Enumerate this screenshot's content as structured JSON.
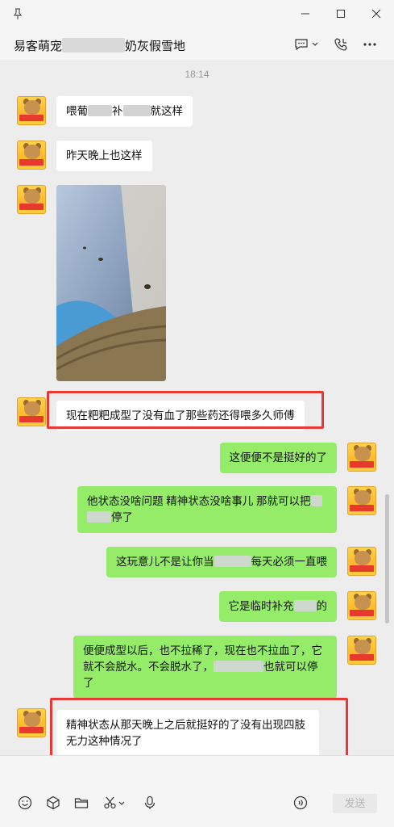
{
  "header": {
    "chat_title_left": "易客萌宠",
    "chat_title_right": "奶灰假雪地"
  },
  "messages": {
    "time": "18:14",
    "m1_a": "喂葡",
    "m1_b": "补",
    "m1_c": "就这样",
    "m2": "昨天晚上也这样",
    "m4": "现在粑粑成型了没有血了那些药还得喂多久师傅",
    "m5": "这便便不是挺好的了",
    "m6_a": "他状态没啥问题 精神状态没啥事儿 那就可以把",
    "m6_b": "停了",
    "m7_a": "这玩意儿不是让你当",
    "m7_b": "每天必须一直喂",
    "m8_a": "它是临时补充",
    "m8_b": "的",
    "m9_a": "便便成型以后，也不拉稀了，现在也不拉血了，它就不会脱水。不会脱水了，",
    "m9_b": "也就可以停了",
    "m10": "精神状态从那天晚上之后就挺好的了没有出现四肢无力这种情况了"
  },
  "input": {
    "send_label": "发送"
  },
  "icons": {
    "pin": "pin-icon",
    "minimize": "minimize-icon",
    "maximize": "maximize-icon",
    "close": "close-icon",
    "chat_bubble": "chat-bubble-icon",
    "call": "phone-call-icon",
    "more": "more-icon",
    "emoji": "emoji-icon",
    "favorites": "cube-icon",
    "folder": "folder-icon",
    "screenshot": "scissors-icon",
    "voice": "microphone-icon",
    "voice_message": "voice-message-icon"
  },
  "colors": {
    "sent_bubble": "#95ec69",
    "received_bubble": "#ffffff",
    "highlight_box": "#e53935",
    "chat_background": "#ededed"
  }
}
